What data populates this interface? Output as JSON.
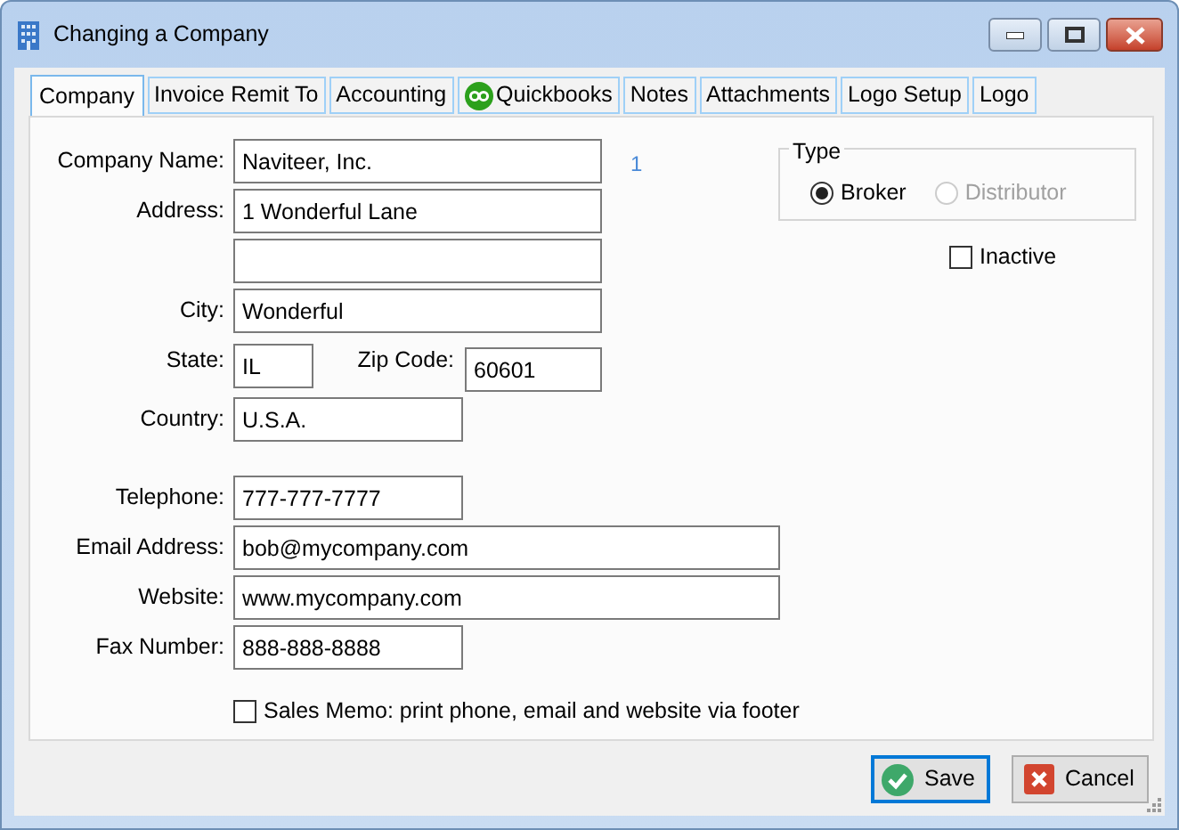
{
  "window": {
    "title": "Changing a Company"
  },
  "tabs": [
    {
      "label": "Company",
      "selected": true,
      "kind": "text"
    },
    {
      "label": "Invoice Remit To",
      "selected": false,
      "kind": "text"
    },
    {
      "label": "Accounting",
      "selected": false,
      "kind": "text"
    },
    {
      "label": "Quickbooks",
      "selected": false,
      "kind": "quickbooks"
    },
    {
      "label": "Notes",
      "selected": false,
      "kind": "text"
    },
    {
      "label": "Attachments",
      "selected": false,
      "kind": "text"
    },
    {
      "label": "Logo Setup",
      "selected": false,
      "kind": "text"
    },
    {
      "label": "Logo",
      "selected": false,
      "kind": "text"
    }
  ],
  "fields": [
    {
      "label": "Company Name:",
      "value": "Naviteer, Inc."
    },
    {
      "label": "Address:",
      "value": "1 Wonderful Lane",
      "second_line": true
    },
    {
      "label": "City:",
      "value": "Wonderful"
    },
    {
      "label": "State:",
      "value": "IL"
    },
    {
      "label": "Zip Code:",
      "value": "60601"
    },
    {
      "label": "Country:",
      "value": "U.S.A."
    },
    {
      "label": "Telephone:",
      "value": "777-777-7777"
    },
    {
      "label": "Email Address:",
      "value": "bob@mycompany.com"
    },
    {
      "label": "Website:",
      "value": "www.mycompany.com"
    },
    {
      "label": "Fax Number:",
      "value": "888-888-8888"
    }
  ],
  "record_number": "1",
  "type_group": {
    "label": "Type",
    "options": [
      {
        "label": "Broker",
        "selected": true,
        "disabled": false
      },
      {
        "label": "Distributor",
        "selected": false,
        "disabled": true
      }
    ]
  },
  "inactive": {
    "label": "Inactive",
    "checked": false
  },
  "sales_memo": {
    "label": "Sales Memo: print phone, email and website via footer",
    "checked": false
  },
  "buttons": [
    {
      "label": "Save",
      "kind": "save",
      "focused": true
    },
    {
      "label": "Cancel",
      "kind": "cancel",
      "focused": false
    }
  ]
}
